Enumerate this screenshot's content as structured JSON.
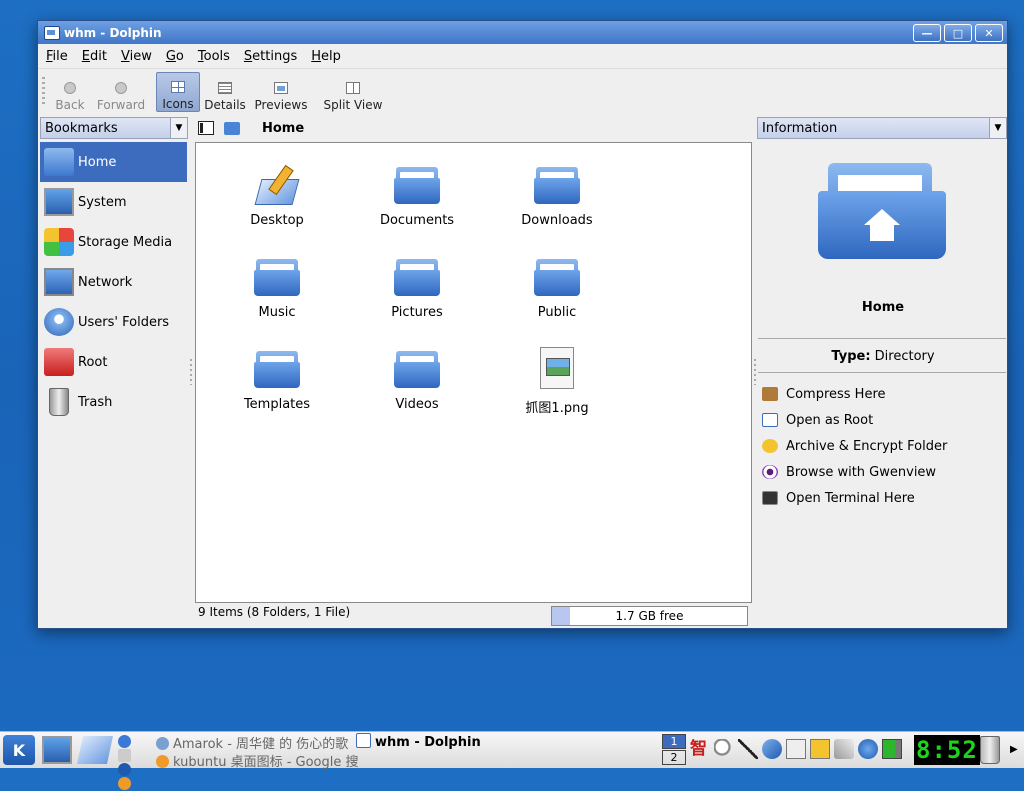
{
  "window": {
    "title": "whm - Dolphin",
    "buttons": {
      "minimize": "—",
      "maximize": "□",
      "close": "✕"
    }
  },
  "menu": [
    "File",
    "Edit",
    "View",
    "Go",
    "Tools",
    "Settings",
    "Help"
  ],
  "toolbar": {
    "back": "Back",
    "forward": "Forward",
    "icons": "Icons",
    "details": "Details",
    "previews": "Previews",
    "split_view": "Split View"
  },
  "bookmarks": {
    "label": "Bookmarks",
    "items": [
      "Home",
      "System",
      "Storage Media",
      "Network",
      "Users' Folders",
      "Root",
      "Trash"
    ]
  },
  "location": {
    "path": "Home"
  },
  "files": [
    {
      "name": "Desktop"
    },
    {
      "name": "Documents"
    },
    {
      "name": "Downloads"
    },
    {
      "name": "Music"
    },
    {
      "name": "Pictures"
    },
    {
      "name": "Public"
    },
    {
      "name": "Templates"
    },
    {
      "name": "Videos"
    },
    {
      "name": "抓图1.png"
    }
  ],
  "status": {
    "summary": "9 Items (8 Folders, 1 File)",
    "free": "1.7 GB free",
    "used_fraction": 0.09
  },
  "information": {
    "label": "Information",
    "title": "Home",
    "type_label": "Type:",
    "type_value": "Directory",
    "actions": [
      "Compress Here",
      "Open as Root",
      "Archive & Encrypt Folder",
      "Browse with Gwenview",
      "Open Terminal Here"
    ]
  },
  "taskbar": {
    "k_menu": "K",
    "tasks": [
      "Amarok - 周华健 的 伤心的歌",
      "kubuntu 桌面图标 - Google 搜",
      "whm - Dolphin"
    ],
    "pager": [
      "1",
      "2"
    ],
    "tray_im": "智",
    "clock": "8:52",
    "next_arrow": "▶"
  },
  "colors": {
    "desktop": "#1a64b8",
    "selection": "#3d6cbf",
    "folder": "#3d78cf",
    "clock": "#1ad61a"
  }
}
